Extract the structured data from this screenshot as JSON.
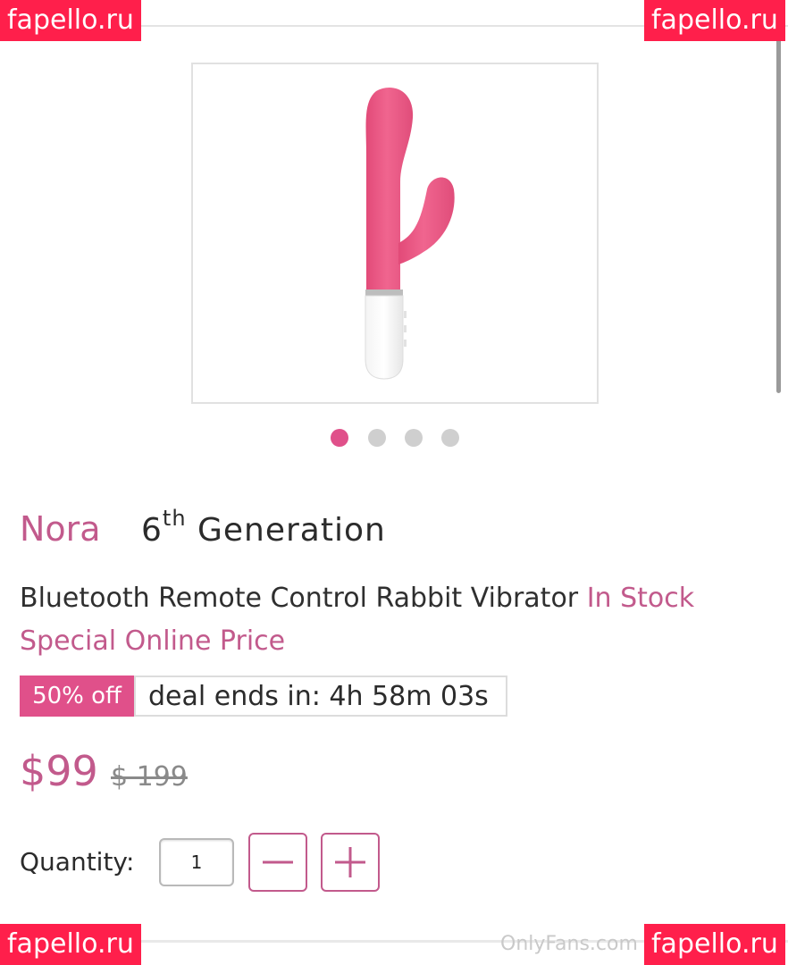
{
  "watermarks": {
    "top_left": "fapello.ru",
    "top_right": "fapello.ru",
    "bottom_left": "fapello.ru",
    "bottom_right": "fapello.ru",
    "bottom_source": "OnlyFans.com"
  },
  "carousel": {
    "image_icon": "rabbit-vibrator-product-image",
    "slides_total": 4,
    "active_slide": 1
  },
  "product": {
    "brand": "Nora",
    "generation_number": "6",
    "generation_suffix": "th",
    "generation_word": "Generation",
    "description": "Bluetooth Remote Control Rabbit Vibrator",
    "stock_status": "In Stock",
    "special_price_label": "Special Online Price"
  },
  "deal": {
    "discount": "50% off",
    "countdown": "deal ends in: 4h 58m 03s"
  },
  "pricing": {
    "price": "$99",
    "original_price": "$ 199"
  },
  "quantity": {
    "label": "Quantity:",
    "value": "1",
    "decrement_icon": "minus-icon",
    "increment_icon": "plus-icon"
  },
  "colors": {
    "accent_pink": "#c25a8c",
    "badge_pink": "#e0508a",
    "watermark_red": "#ff1f4b",
    "product_pink": "#ee5a86"
  }
}
